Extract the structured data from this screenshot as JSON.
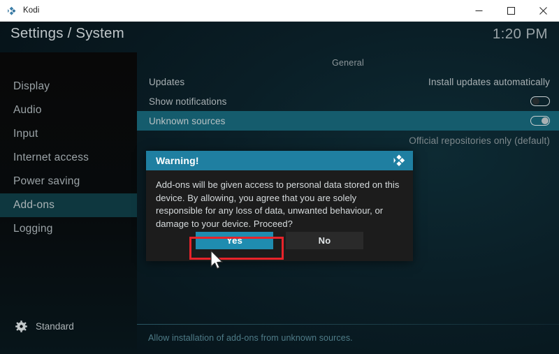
{
  "window": {
    "app_title": "Kodi",
    "app_icon": "kodi-logo-icon",
    "controls": {
      "minimize": "minimize-icon",
      "maximize": "maximize-icon",
      "close": "close-icon"
    }
  },
  "header": {
    "breadcrumb": "Settings / System",
    "clock": "1:20 PM"
  },
  "sidebar": {
    "items": [
      {
        "label": "Display",
        "selected": false
      },
      {
        "label": "Audio",
        "selected": false
      },
      {
        "label": "Input",
        "selected": false
      },
      {
        "label": "Internet access",
        "selected": false
      },
      {
        "label": "Power saving",
        "selected": false
      },
      {
        "label": "Add-ons",
        "selected": true
      },
      {
        "label": "Logging",
        "selected": false
      }
    ],
    "footer": {
      "icon": "gear-icon",
      "label": "Standard"
    }
  },
  "main": {
    "group_title": "General",
    "rows": [
      {
        "label": "Updates",
        "value": "Install updates automatically",
        "type": "value",
        "selected": false
      },
      {
        "label": "Show notifications",
        "value": "",
        "type": "toggle",
        "toggle_on": false,
        "selected": false
      },
      {
        "label": "Unknown sources",
        "value": "",
        "type": "toggle",
        "toggle_on": true,
        "selected": true
      },
      {
        "label": "",
        "value": "Official repositories only (default)",
        "type": "value",
        "selected": false
      }
    ],
    "help_text": "Allow installation of add-ons from unknown sources."
  },
  "dialog": {
    "title": "Warning!",
    "logo_icon": "kodi-logo-icon",
    "message": "Add-ons will be given access to personal data stored on this device. By allowing, you agree that you are solely responsible for any loss of data, unwanted behaviour, or damage to your device. Proceed?",
    "buttons": {
      "yes": "Yes",
      "no": "No"
    }
  },
  "annotation": {
    "highlight_color": "#e8232a",
    "target": "yes-button",
    "cursor": "mouse-pointer-icon"
  },
  "colors": {
    "accent_teal": "#1f8cb0",
    "dialog_header": "#1f7fa1",
    "row_selected": "#155c6d",
    "sidebar_selected": "#0e373f",
    "help_text": "#4f7c88"
  }
}
